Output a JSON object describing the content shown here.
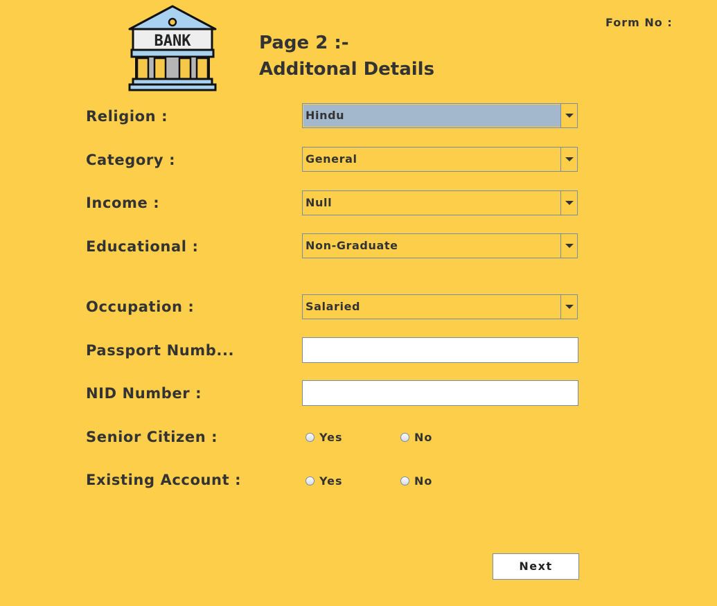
{
  "header": {
    "form_no_label": "Form No :",
    "logo_text": "BANK",
    "title_line1": "Page 2 :-",
    "title_line2": "Additonal Details"
  },
  "fields": {
    "religion": {
      "label": "Religion :",
      "value": "Hindu"
    },
    "category": {
      "label": "Category :",
      "value": "General"
    },
    "income": {
      "label": "Income :",
      "value": "Null"
    },
    "educational": {
      "label": "Educational :",
      "value": "Non-Graduate"
    },
    "occupation": {
      "label": "Occupation :",
      "value": "Salaried"
    },
    "passport": {
      "label": "Passport Numb...",
      "value": ""
    },
    "nid": {
      "label": "NID Number :",
      "value": ""
    },
    "senior_citizen": {
      "label": "Senior Citizen :",
      "yes": "Yes",
      "no": "No"
    },
    "existing_account": {
      "label": "Existing Account :",
      "yes": "Yes",
      "no": "No"
    }
  },
  "actions": {
    "next_label": "Next"
  },
  "colors": {
    "background": "#fcce4a",
    "selection": "#a3b8cc"
  }
}
